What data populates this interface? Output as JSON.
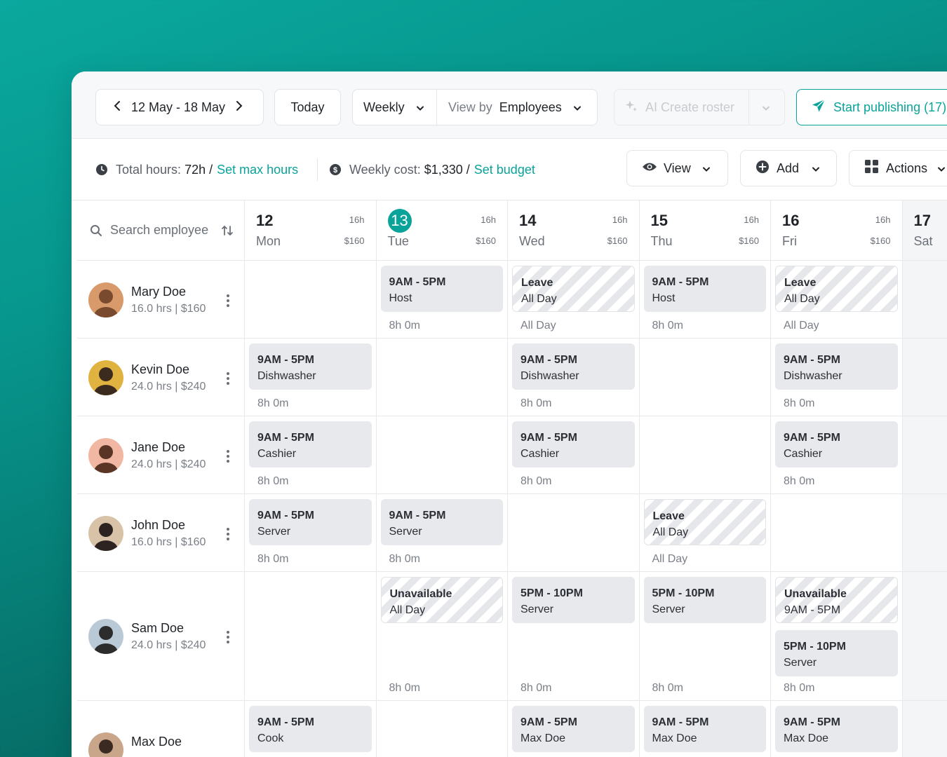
{
  "toolbar": {
    "date_range": "12 May - 18 May",
    "today_label": "Today",
    "period_label": "Weekly",
    "view_by_prefix": "View by",
    "view_by_value": "Employees",
    "ai_create_label": "AI Create roster",
    "publish_label": "Start publishing (17)"
  },
  "stats": {
    "total_hours_label": "Total hours:",
    "total_hours_value": "72h /",
    "set_max_hours": "Set max hours",
    "weekly_cost_label": "Weekly cost:",
    "weekly_cost_value": "$1,330 /",
    "set_budget": "Set budget",
    "view_label": "View",
    "add_label": "Add",
    "actions_label": "Actions"
  },
  "search": {
    "placeholder": "Search employee"
  },
  "days": [
    {
      "num": "12",
      "weekday": "Mon",
      "hours": "16h",
      "cost": "$160"
    },
    {
      "num": "13",
      "weekday": "Tue",
      "hours": "16h",
      "cost": "$160",
      "today": true
    },
    {
      "num": "14",
      "weekday": "Wed",
      "hours": "16h",
      "cost": "$160"
    },
    {
      "num": "15",
      "weekday": "Thu",
      "hours": "16h",
      "cost": "$160"
    },
    {
      "num": "16",
      "weekday": "Fri",
      "hours": "16h",
      "cost": "$160"
    },
    {
      "num": "17",
      "weekday": "Sat",
      "hours": "",
      "cost": ""
    }
  ],
  "employees": [
    {
      "name": "Mary Doe",
      "meta": "16.0 hrs | $160",
      "shifts": [
        null,
        {
          "l1": "9AM - 5PM",
          "l2": "Host",
          "dur": "8h 0m"
        },
        {
          "l1": "Leave",
          "l2": "All Day",
          "dur": "All Day",
          "hatch": true
        },
        {
          "l1": "9AM - 5PM",
          "l2": "Host",
          "dur": "8h 0m"
        },
        {
          "l1": "Leave",
          "l2": "All Day",
          "dur": "All Day",
          "hatch": true
        },
        null
      ]
    },
    {
      "name": "Kevin Doe",
      "meta": "24.0 hrs | $240",
      "shifts": [
        {
          "l1": "9AM - 5PM",
          "l2": "Dishwasher",
          "dur": "8h 0m"
        },
        null,
        {
          "l1": "9AM - 5PM",
          "l2": "Dishwasher",
          "dur": "8h 0m"
        },
        null,
        {
          "l1": "9AM - 5PM",
          "l2": "Dishwasher",
          "dur": "8h 0m"
        },
        null
      ]
    },
    {
      "name": "Jane Doe",
      "meta": "24.0 hrs | $240",
      "shifts": [
        {
          "l1": "9AM - 5PM",
          "l2": "Cashier",
          "dur": "8h 0m"
        },
        null,
        {
          "l1": "9AM - 5PM",
          "l2": "Cashier",
          "dur": "8h 0m"
        },
        null,
        {
          "l1": "9AM - 5PM",
          "l2": "Cashier",
          "dur": "8h 0m"
        },
        null
      ]
    },
    {
      "name": "John Doe",
      "meta": "16.0 hrs | $160",
      "shifts": [
        {
          "l1": "9AM - 5PM",
          "l2": "Server",
          "dur": "8h 0m"
        },
        {
          "l1": "9AM - 5PM",
          "l2": "Server",
          "dur": "8h 0m"
        },
        null,
        {
          "l1": "Leave",
          "l2": "All Day",
          "dur": "All Day",
          "hatch": true
        },
        null,
        null
      ]
    },
    {
      "name": "Sam Doe",
      "meta": "24.0 hrs | $240",
      "shifts": [
        null,
        {
          "l1": "Unavailable",
          "l2": "All Day",
          "dur": "8h 0m",
          "hatch": true
        },
        {
          "l1": "5PM - 10PM",
          "l2": "Server",
          "dur": "8h 0m"
        },
        {
          "l1": "5PM - 10PM",
          "l2": "Server",
          "dur": "8h 0m"
        },
        {
          "l1": "Unavailable",
          "l2": "9AM - 5PM",
          "dur": "8h 0m",
          "hatch": true,
          "extra": {
            "l1": "5PM - 10PM",
            "l2": "Server"
          }
        },
        null
      ]
    },
    {
      "name": "Max Doe",
      "meta": "",
      "shifts": [
        {
          "l1": "9AM - 5PM",
          "l2": "Cook",
          "dur": ""
        },
        null,
        {
          "l1": "9AM - 5PM",
          "l2": "Max Doe",
          "dur": ""
        },
        {
          "l1": "9AM - 5PM",
          "l2": "Max Doe",
          "dur": ""
        },
        {
          "l1": "9AM - 5PM",
          "l2": "Max Doe",
          "dur": ""
        },
        null
      ]
    }
  ],
  "colors": {
    "accent": "#0aa39a",
    "shift_bg": "#e8e9ec"
  }
}
